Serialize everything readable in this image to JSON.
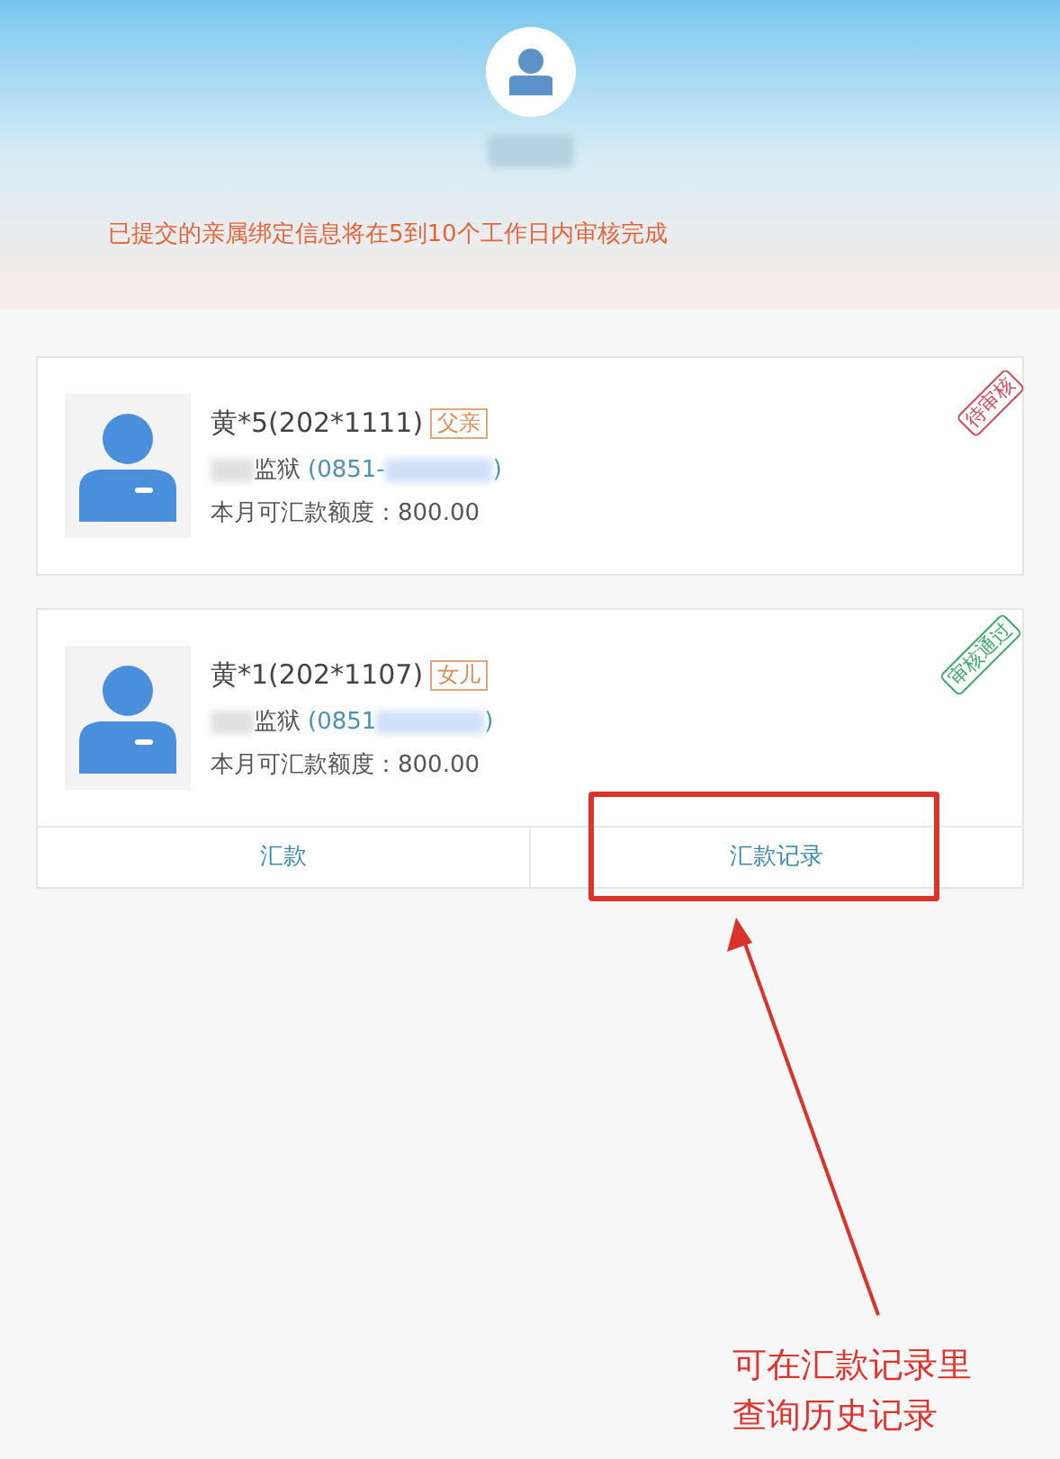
{
  "header": {
    "notice": "已提交的亲属绑定信息将在5到10个工作日内审核完成"
  },
  "cards": [
    {
      "name": "黄*5(202*1111)",
      "relation": "父亲",
      "prison": "监狱",
      "phone": "(0851-",
      "phone_end": ")",
      "quota": "本月可汇款额度：800.00",
      "status": {
        "kind": "pending",
        "label": "待审核"
      }
    },
    {
      "name": "黄*1(202*1107)",
      "relation": "女儿",
      "prison": "监狱",
      "phone": "(0851",
      "phone_end": ")",
      "quota": "本月可汇款额度：800.00",
      "status": {
        "kind": "approved",
        "label": "审核通过"
      },
      "actions": [
        "汇款",
        "汇款记录"
      ]
    }
  ],
  "annotation": {
    "text": "可在汇款记录里查询历史记录"
  }
}
